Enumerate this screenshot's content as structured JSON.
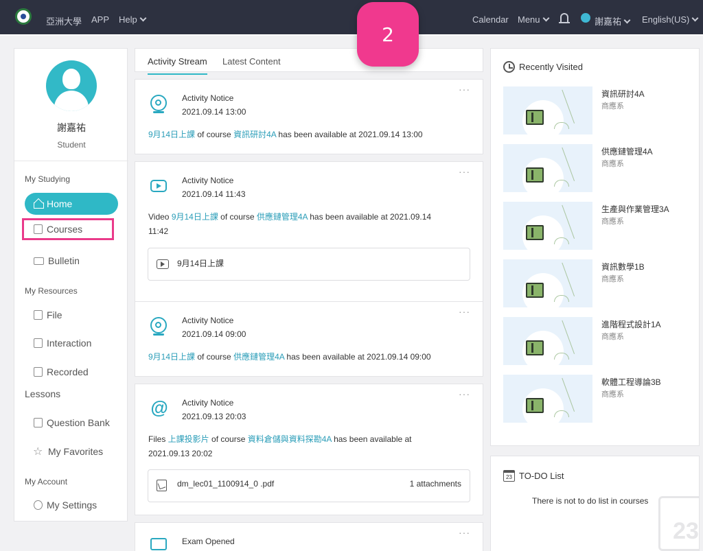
{
  "topbar": {
    "school": "亞洲大學",
    "app": "APP",
    "help": "Help",
    "calendar": "Calendar",
    "menu": "Menu",
    "user": "謝嘉祐",
    "language": "English(US)"
  },
  "step_badge": "2",
  "profile": {
    "name": "謝嘉祐",
    "role": "Student"
  },
  "sidebar": {
    "sections": {
      "studying": "My Studying",
      "resources": "My Resources",
      "account": "My Account"
    },
    "items": {
      "home": "Home",
      "courses": "Courses",
      "bulletin": "Bulletin",
      "file": "File",
      "interaction": "Interaction",
      "recorded": "Recorded",
      "recorded_2": "Lessons",
      "question_bank": "Question Bank",
      "favorites": "My Favorites",
      "settings": "My Settings"
    }
  },
  "tabs": {
    "stream": "Activity Stream",
    "latest": "Latest Content"
  },
  "more": "···",
  "cards": [
    {
      "title": "Activity Notice",
      "time": "2021.09.14 13:00",
      "link1": "9月14日上課",
      "mid": " of course ",
      "link2": "資訊研討4A",
      "tail": " has been available at 2021.09.14 13:00"
    },
    {
      "title": "Activity Notice",
      "time": "2021.09.14 11:43",
      "pre": "Video ",
      "link1": "9月14日上課",
      "mid": " of course ",
      "link2": "供應鏈管理4A",
      "tail": " has been available at 2021.09.14",
      "tail2": "11:42",
      "sub": "9月14日上課"
    },
    {
      "title": "Activity Notice",
      "time": "2021.09.14 09:00",
      "link1": "9月14日上課",
      "mid": " of course ",
      "link2": "供應鏈管理4A",
      "tail": " has been available at 2021.09.14 09:00"
    },
    {
      "title": "Activity Notice",
      "time": "2021.09.13 20:03",
      "pre": "Files ",
      "link1": "上課投影片",
      "mid": " of course ",
      "link2": "資料倉儲與資料探勘4A",
      "tail": " has been available at",
      "tail2": "2021.09.13 20:02",
      "sub": "dm_lec01_1100914_0 .pdf",
      "sub_right": "1 attachments"
    },
    {
      "title": "Exam Opened"
    }
  ],
  "recently_visited": {
    "title": "Recently Visited",
    "items": [
      {
        "name": "資訊研討4A",
        "dept": "商應系"
      },
      {
        "name": "供應鏈管理4A",
        "dept": "商應系"
      },
      {
        "name": "生產與作業管理3A",
        "dept": "商應系"
      },
      {
        "name": "資訊數學1B",
        "dept": "商應系"
      },
      {
        "name": "進階程式設計1A",
        "dept": "商應系"
      },
      {
        "name": "軟體工程導論3B",
        "dept": "商應系"
      }
    ]
  },
  "todo": {
    "title": "TO-DO List",
    "cal_day": "23",
    "empty": "There is not to do list in courses",
    "big_day": "23"
  }
}
